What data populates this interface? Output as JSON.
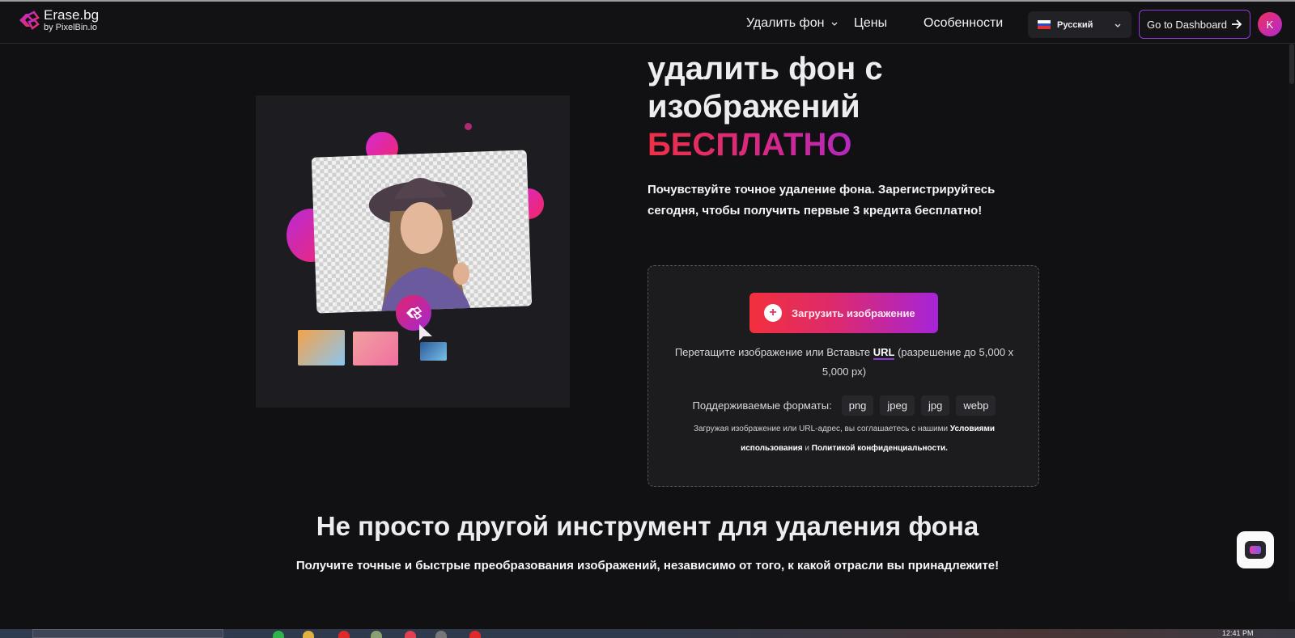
{
  "brand": {
    "name": "Erase.bg",
    "by": "by PixelBin.io",
    "accent_start": "#ee3045",
    "accent_end": "#a52ad5"
  },
  "nav": {
    "items": [
      {
        "label": "Удалить фон",
        "has_dropdown": true
      },
      {
        "label": "Цены",
        "has_dropdown": false
      },
      {
        "label": "Особенности",
        "has_dropdown": false
      }
    ],
    "language": {
      "selected": "Русский",
      "flag": "ru-flag"
    },
    "dashboard_button": "Go to Dashboard",
    "avatar_initial": "K"
  },
  "hero": {
    "title_line1": "удалить фон с",
    "title_line2": "изображений",
    "title_highlight": "БЕСПЛАТНО",
    "lead": "Почувствуйте точное удаление фона. Зарегистрируйтесь сегодня, чтобы получить первые 3 кредита бесплатно!"
  },
  "upload": {
    "button_label": "Загрузить изображение",
    "drop_text_before": "Перетащите изображение или Вставьте ",
    "url_link": "URL",
    "drop_text_after": " (разрешение до 5,000 x 5,000 px)",
    "formats_label": "Поддерживаемые форматы:",
    "formats": [
      "png",
      "jpeg",
      "jpg",
      "webp"
    ],
    "terms_before": "Загружая изображение или URL-адрес, вы соглашаетесь с нашими ",
    "terms_link": "Условиями использования",
    "terms_mid": " и ",
    "privacy_link": "Политикой конфиденциальности."
  },
  "section2": {
    "title": "Не просто другой инструмент для удаления фона",
    "subtitle": "Получите точные и быстрые преобразования изображений, независимо от того, к какой отрасли вы принадлежите!"
  },
  "taskbar": {
    "clock": "12:41 PM"
  }
}
